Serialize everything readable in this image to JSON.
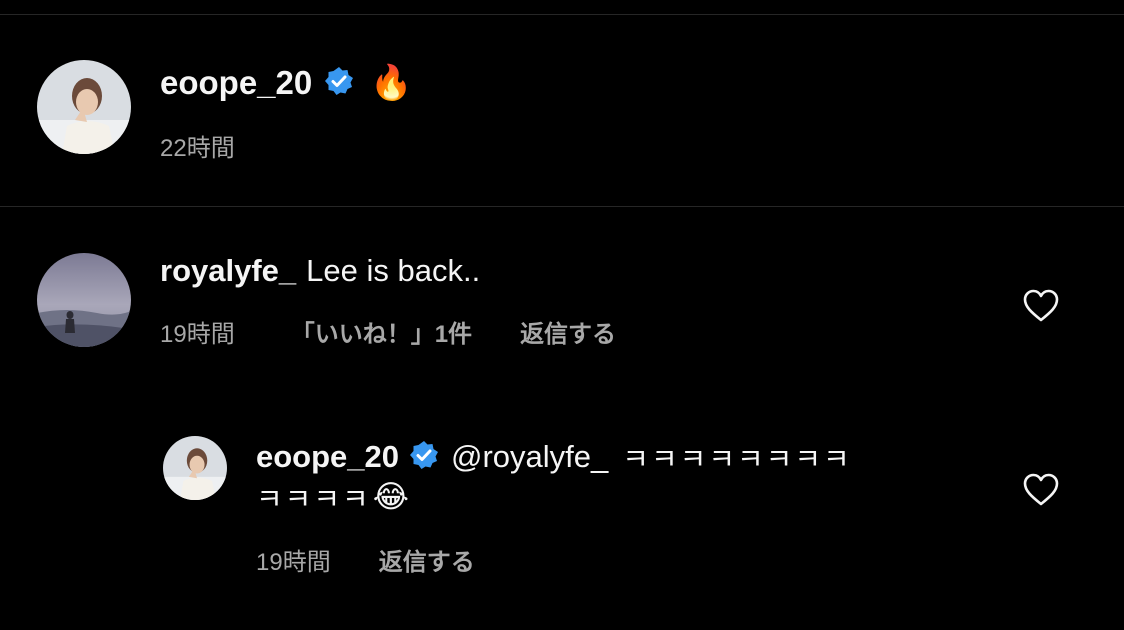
{
  "caption": {
    "username": "eoope_20",
    "text": "🔥",
    "time": "22時間"
  },
  "comment": {
    "username": "royalyfe_",
    "text": "Lee is back..",
    "time": "19時間",
    "likes": "「いいね！」1件",
    "reply_label": "返信する"
  },
  "reply": {
    "username": "eoope_20",
    "mention": "@royalyfe_",
    "text_line1": "ㅋㅋㅋㅋㅋㅋㅋㅋ",
    "text_line2": "ㅋㅋㅋㅋ",
    "emoji": "😂",
    "time": "19時間",
    "reply_label": "返信する"
  },
  "colors": {
    "background": "#000000",
    "primary_text": "#f5f5f5",
    "secondary_text": "#a8a8a8",
    "verified": "#3897f0",
    "divider": "#262626"
  },
  "icons": {
    "verified": "verified-badge-icon",
    "heart": "heart-outline-icon"
  }
}
